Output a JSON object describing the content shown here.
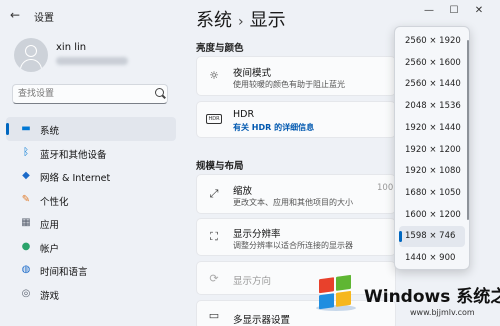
{
  "window": {
    "app_title": "设置",
    "controls": {
      "minimize": "—",
      "maximize": "☐",
      "close": "✕"
    }
  },
  "profile": {
    "name": "xin lin"
  },
  "search": {
    "placeholder": "查找设置"
  },
  "sidebar": {
    "items": [
      {
        "label": "系统",
        "icon": "monitor-icon",
        "color": "#0078d4",
        "active": true
      },
      {
        "label": "蓝牙和其他设备",
        "icon": "bluetooth-icon",
        "color": "#0078d4"
      },
      {
        "label": "网络 & Internet",
        "icon": "wifi-icon",
        "color": "#1b6ac9"
      },
      {
        "label": "个性化",
        "icon": "paintbrush-icon",
        "color": "#e07b2a"
      },
      {
        "label": "应用",
        "icon": "apps-icon",
        "color": "#5a6270"
      },
      {
        "label": "帐户",
        "icon": "person-icon",
        "color": "#2aa36b"
      },
      {
        "label": "时间和语言",
        "icon": "globe-clock-icon",
        "color": "#1b6ac9"
      },
      {
        "label": "游戏",
        "icon": "gamepad-icon",
        "color": "#5a6270"
      }
    ]
  },
  "breadcrumb": {
    "parent": "系统",
    "separator": "›",
    "current": "显示"
  },
  "sections": {
    "brightness_color": "亮度与颜色",
    "scale_layout": "规模与布局"
  },
  "cards": {
    "night_light": {
      "title": "夜间模式",
      "subtitle": "使用较暖的颜色有助于阻止蓝光",
      "icon": "sun-icon"
    },
    "hdr": {
      "title": "HDR",
      "link": "有关 HDR 的详细信息",
      "icon": "hdr-icon",
      "icon_text": "HDR"
    },
    "scale": {
      "title": "缩放",
      "subtitle": "更改文本、应用和其他项目的大小",
      "icon": "scale-icon",
      "value": "100"
    },
    "resolution": {
      "title": "显示分辨率",
      "subtitle": "调整分辨率以适合所连接的显示器",
      "icon": "resolution-icon"
    },
    "orientation": {
      "title": "显示方向",
      "icon": "rotate-icon"
    },
    "multi_display": {
      "title": "多显示器设置",
      "icon": "multi-monitor-icon"
    }
  },
  "resolution_dropdown": {
    "options": [
      "2560 × 1920",
      "2560 × 1600",
      "2560 × 1440",
      "2048 × 1536",
      "1920 × 1440",
      "1920 × 1200",
      "1920 × 1080",
      "1680 × 1050",
      "1600 × 1200",
      "1598 × 746",
      "1440 × 900"
    ],
    "selected": "1598 × 746"
  },
  "watermark": {
    "title": "Windows 系统之家",
    "url": "www.bjjmlv.com"
  },
  "colors": {
    "accent": "#0067c0",
    "link": "#0058b0"
  }
}
